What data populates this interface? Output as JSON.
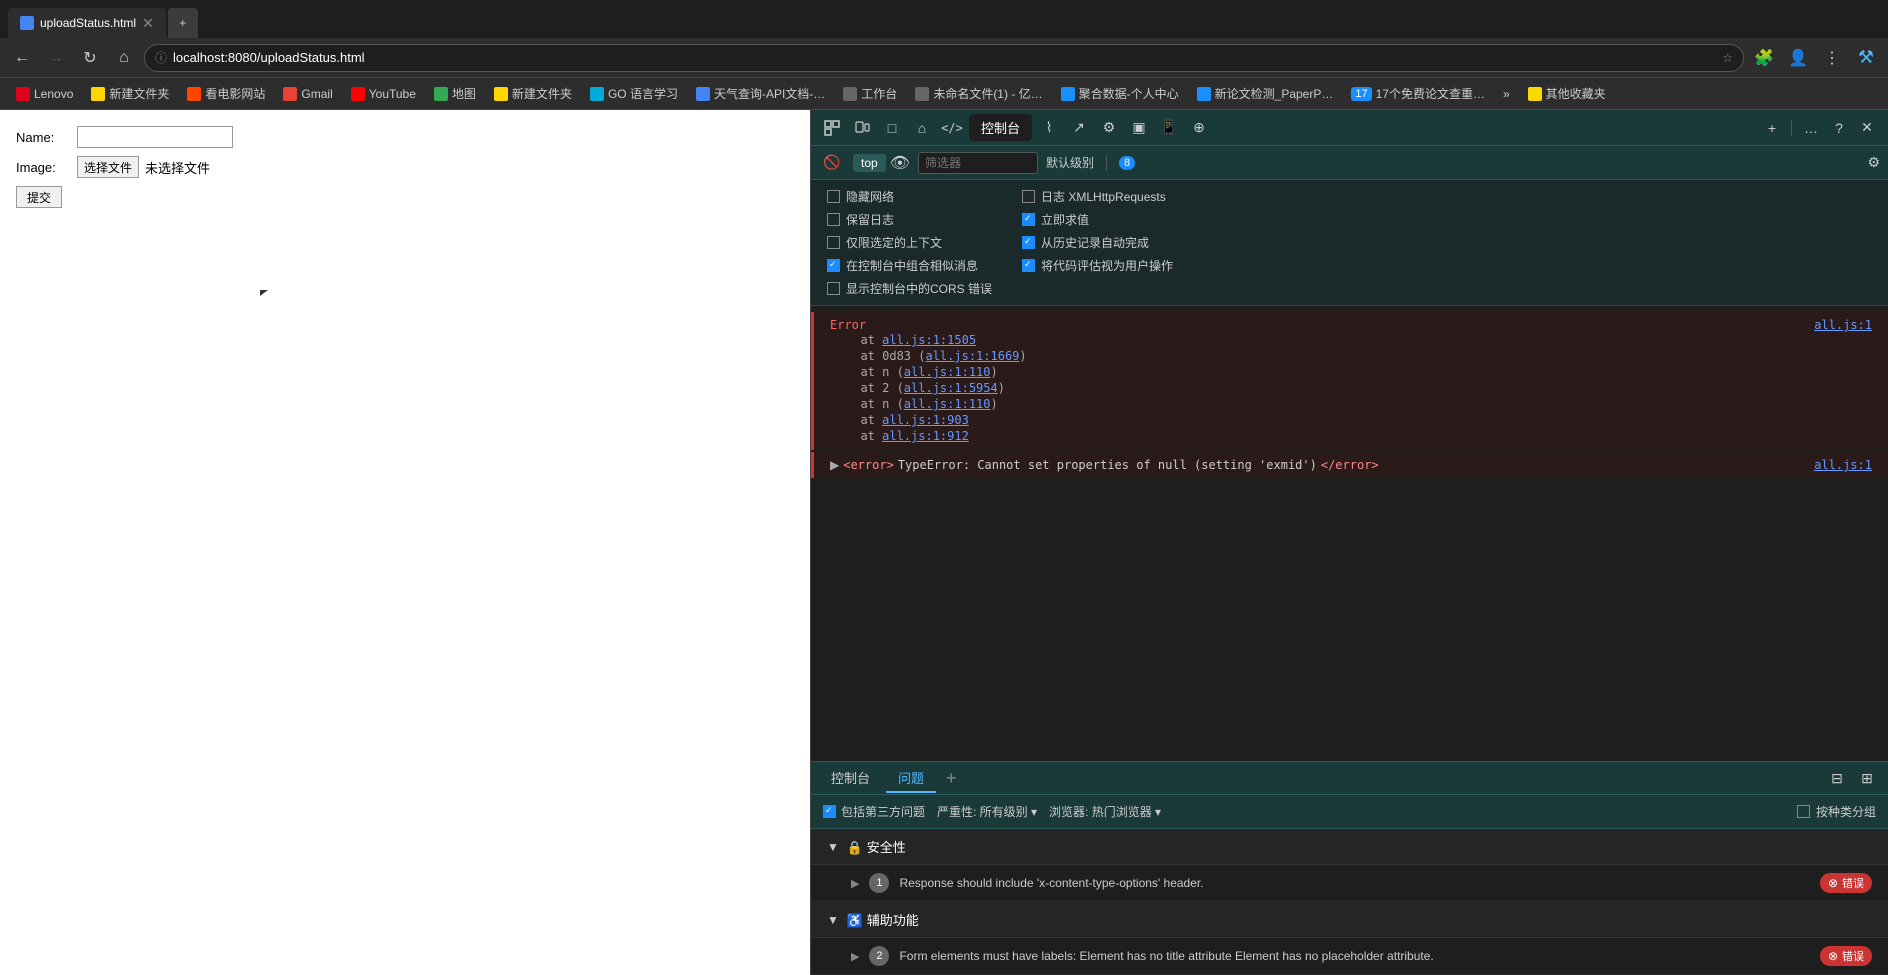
{
  "browser": {
    "address": "localhost:8080/uploadStatus.html",
    "tab_title": "uploadStatus.html"
  },
  "bookmarks": [
    {
      "id": "lenovo",
      "label": "Lenovo",
      "color": "#e0001a"
    },
    {
      "id": "new-folder",
      "label": "新建文件夹",
      "color": "#ffd700"
    },
    {
      "id": "movie",
      "label": "看电影网站",
      "color": "#ff4500"
    },
    {
      "id": "gmail",
      "label": "Gmail",
      "color": "#ea4335"
    },
    {
      "id": "youtube",
      "label": "YouTube",
      "color": "#ff0000"
    },
    {
      "id": "maps",
      "label": "地图",
      "color": "#34a853"
    },
    {
      "id": "new-folder2",
      "label": "新建文件夹",
      "color": "#ffd700"
    },
    {
      "id": "go-lang",
      "label": "GO 语言学习",
      "color": "#00acd7"
    },
    {
      "id": "weather",
      "label": "天气查询-API文档-…",
      "color": "#4285f4"
    },
    {
      "id": "workspace",
      "label": "工作台",
      "color": "#666"
    },
    {
      "id": "unnamed",
      "label": "未命名文件(1) - 亿…",
      "color": "#666"
    },
    {
      "id": "data",
      "label": "聚合数据-个人中心",
      "color": "#1890ff"
    },
    {
      "id": "paper",
      "label": "新论文检测_PaperP…",
      "color": "#1890ff"
    },
    {
      "id": "free",
      "label": "17个免费论文查重…",
      "color": "#1890ff"
    },
    {
      "id": "more",
      "label": "»",
      "color": "#666"
    },
    {
      "id": "other",
      "label": "其他收藏夹",
      "color": "#ffd700"
    }
  ],
  "webpage": {
    "name_label": "Name:",
    "image_label": "Image:",
    "choose_file_btn": "选择文件",
    "no_file_label": "未选择文件",
    "submit_btn": "提交"
  },
  "devtools": {
    "active_panel": "控制台",
    "filter_text": "",
    "filter_placeholder": "筛选器",
    "level_select": "默认级别",
    "error_count": "8",
    "options": {
      "left": [
        {
          "id": "hide-network",
          "label": "隐藏网络",
          "checked": false
        },
        {
          "id": "preserve-log",
          "label": "保留日志",
          "checked": false
        },
        {
          "id": "selected-context",
          "label": "仅限选定的上下文",
          "checked": false
        },
        {
          "id": "group-similar",
          "label": "在控制台中组合相似消息",
          "checked": true
        },
        {
          "id": "show-cors",
          "label": "显示控制台中的CORS 错误",
          "checked": false
        }
      ],
      "right": [
        {
          "id": "log-xmlhttp",
          "label": "日志 XMLHttpRequests",
          "checked": false
        },
        {
          "id": "eager-eval",
          "label": "立即求值",
          "checked": true
        },
        {
          "id": "autocomplete",
          "label": "从历史记录自动完成",
          "checked": true
        },
        {
          "id": "user-gesture",
          "label": "将代码评估视为用户操作",
          "checked": true
        }
      ]
    },
    "console_output": {
      "error_header": "Error",
      "error_link_header": "all.js:1",
      "stack_lines": [
        {
          "text": "at all.js:1:1505",
          "link": "all.js:1:1505"
        },
        {
          "text": "at 0d83 (all.js:1:1669)",
          "link": "all.js:1:1669"
        },
        {
          "text": "at n (all.js:1:110)",
          "link": "all.js:1:110"
        },
        {
          "text": "at 2 (all.js:1:5954)",
          "link": "all.js:1:5954"
        },
        {
          "text": "at n (all.js:1:110)",
          "link": "all.js:1:110"
        },
        {
          "text": "at all.js:1:903",
          "link": "all.js:1:903"
        },
        {
          "text": "at all.js:1:912",
          "link": "all.js:1:912"
        }
      ],
      "error_message": "TypeError: Cannot set properties of null (setting 'exmid')",
      "error_message_link": "all.js:1"
    },
    "bottom_tabs": [
      {
        "id": "console",
        "label": "控制台",
        "active": false
      },
      {
        "id": "issues",
        "label": "问题",
        "active": true
      }
    ],
    "issues": {
      "filter_bar": {
        "include_third_party_label": "包括第三方问题",
        "include_third_party_checked": true,
        "severity_label": "严重性: 所有级别",
        "browser_label": "浏览器: 热门浏览器",
        "group_by_kind_label": "按种类分组",
        "group_by_kind_checked": false
      },
      "sections": [
        {
          "id": "security",
          "title": "安全性",
          "expanded": true,
          "items": [
            {
              "id": "security-1",
              "num": "1",
              "text": "Response should include 'x-content-type-options' header.",
              "badge": "错误"
            }
          ]
        },
        {
          "id": "accessibility",
          "title": "辅助功能",
          "expanded": true,
          "items": [
            {
              "id": "accessibility-1",
              "num": "2",
              "text": "Form elements must have labels: Element has no title attribute Element has no placeholder attribute.",
              "badge": "错误"
            }
          ]
        }
      ]
    }
  },
  "toolbar_icons": {
    "inspect": "⊹",
    "device": "▭",
    "elements": "□",
    "home": "⌂",
    "code": "</>",
    "console_tab": "控制台",
    "sources": "☆",
    "network": "⌇",
    "performance": "→",
    "settings_gear": "⚙",
    "storage": "▣",
    "mobile": "📱",
    "security_shield": "⊕",
    "add": "+",
    "more": "…",
    "help": "?",
    "close": "✕"
  }
}
